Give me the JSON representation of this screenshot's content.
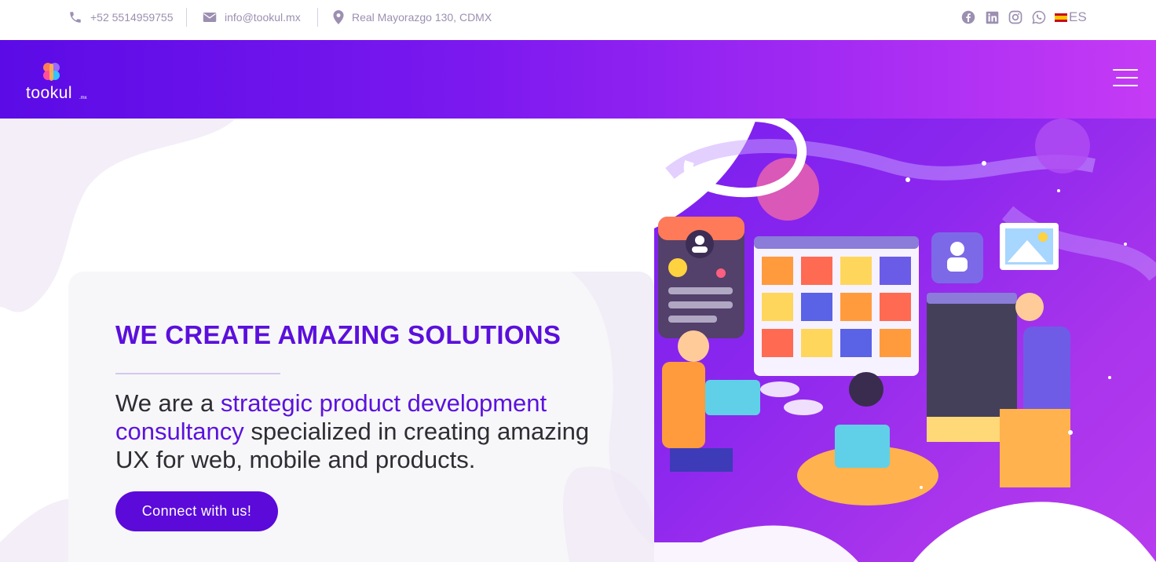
{
  "contact": {
    "phone": "+52 5514959755",
    "email": "info@tookul.mx",
    "address": "Real Mayorazgo 130, CDMX",
    "phone_icon": "phone-icon",
    "email_icon": "envelope-icon",
    "address_icon": "map-pin-icon"
  },
  "social": {
    "icons": [
      "facebook-icon",
      "linkedin-icon",
      "instagram-icon",
      "whatsapp-icon"
    ],
    "language": "ES"
  },
  "header": {
    "logo_text": "tookul",
    "logo_suffix": ".mx",
    "menu_icon": "hamburger-menu-icon"
  },
  "hero": {
    "title": "WE CREATE AMAZING SOLUTIONS",
    "text_prefix": "We are a ",
    "text_highlight": "strategic product development consultancy",
    "text_suffix": " specialized in creating amazing UX for web, mobile and products.",
    "cta_label": "Connect with us!"
  },
  "colors": {
    "brand": "#5b0ad9",
    "topbar_text": "#9c8fb1",
    "header_start": "#5b0be6",
    "header_end": "#c53bf5"
  }
}
